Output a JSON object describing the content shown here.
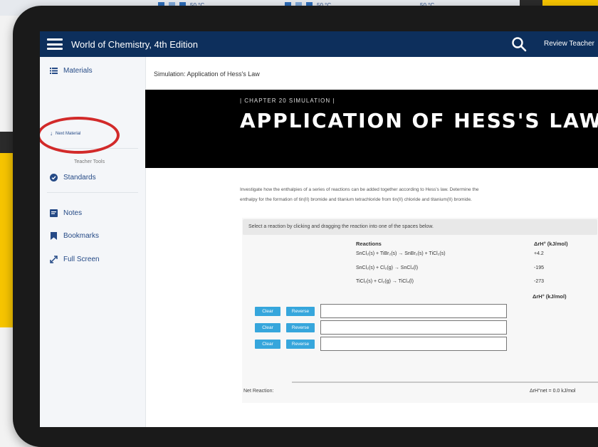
{
  "background": {
    "top_controls": [
      {
        "label": "50 °C"
      },
      {
        "label": "50 °C"
      },
      {
        "label": "50 °C"
      }
    ]
  },
  "header": {
    "title": "World of Chemistry, 4th Edition",
    "review_link": "Review Teacher"
  },
  "sidebar": {
    "materials": "Materials",
    "next_material": "Next Material",
    "teacher_tools": "Teacher Tools",
    "standards": "Standards",
    "notes": "Notes",
    "bookmarks": "Bookmarks",
    "full_screen": "Full Screen"
  },
  "breadcrumb": "Simulation: Application of Hess's Law",
  "banner": {
    "kicker": "| CHAPTER 20 SIMULATION |",
    "title": "APPLICATION OF HESS'S LAW"
  },
  "intro": {
    "line1": "Investigate how the enthalpies of a series of reactions can be added together according to Hess's law. Determine the",
    "line2": "enthalpy for the formation of tin(II) bromide and titanium tetrachloride from tin(II) chloride and titanium(II) bromide."
  },
  "simulation": {
    "instruction": "Select a reaction by clicking and dragging the reaction into one of the spaces below.",
    "reactions_header": "Reactions",
    "dh_header": "ΔrH° (kJ/mol)",
    "reactions": [
      {
        "equation": "SnCl₂(s) + TiBr₂(s) → SnBr₂(s) + TiCl₂(s)",
        "dh": "+4.2"
      },
      {
        "equation": "SnCl₂(s) + Cl₂(g) → SnCl₄(l)",
        "dh": "-195"
      },
      {
        "equation": "TiCl₂(s) + Cl₂(g) → TiCl₄(l)",
        "dh": "-273"
      }
    ],
    "dh_header_2": "ΔrH° (kJ/mol)",
    "rows": [
      {
        "clear": "Clear",
        "reverse": "Reverse"
      },
      {
        "clear": "Clear",
        "reverse": "Reverse"
      },
      {
        "clear": "Clear",
        "reverse": "Reverse"
      }
    ],
    "net_label": "Net Reaction:",
    "net_value": "ΔrH°net = 0.0 kJ/mol"
  },
  "colors": {
    "appbar": "#0d2f5c",
    "button": "#36a6dc",
    "annotation_circle": "#d22a2a",
    "background_accent": "#f6c400"
  }
}
